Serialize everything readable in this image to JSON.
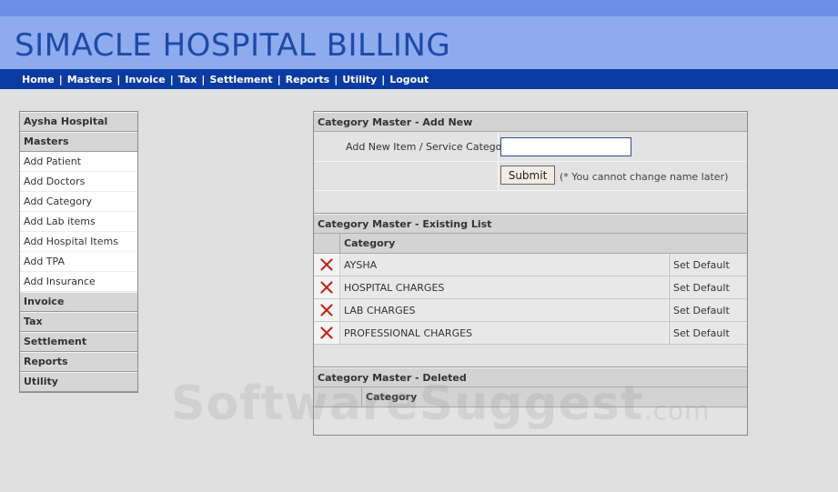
{
  "app_title": "SIMACLE HOSPITAL BILLING",
  "nav": [
    "Home",
    "Masters",
    "Invoice",
    "Tax",
    "Settlement",
    "Reports",
    "Utility",
    "Logout"
  ],
  "sidebar": {
    "hospital": "Aysha Hospital",
    "masters_label": "Masters",
    "masters_items": [
      "Add Patient",
      "Add Doctors",
      "Add Category",
      "Add Lab items",
      "Add Hospital Items",
      "Add TPA",
      "Add Insurance"
    ],
    "sections": [
      "Invoice",
      "Tax",
      "Settlement",
      "Reports",
      "Utility"
    ]
  },
  "add_new": {
    "title": "Category Master - Add New",
    "field_label": "Add New Item / Service Category",
    "input_value": "",
    "submit_label": "Submit",
    "note": "(* You cannot change name later)"
  },
  "existing": {
    "title": "Category Master - Existing List",
    "column": "Category",
    "rows": [
      {
        "name": "AYSHA",
        "action": "Set Default"
      },
      {
        "name": "HOSPITAL CHARGES",
        "action": "Set Default"
      },
      {
        "name": "LAB CHARGES",
        "action": "Set Default"
      },
      {
        "name": "PROFESSIONAL CHARGES",
        "action": "Set Default"
      }
    ]
  },
  "deleted": {
    "title": "Category Master - Deleted",
    "column": "Category"
  },
  "watermark": {
    "brand": "SoftwareSuggest",
    "tld": ".com"
  },
  "colors": {
    "header_bg": "#8eabee",
    "nav_bg": "#0a3ba3",
    "title_text": "#1d4aa8",
    "delete_icon": "#c0281e"
  }
}
